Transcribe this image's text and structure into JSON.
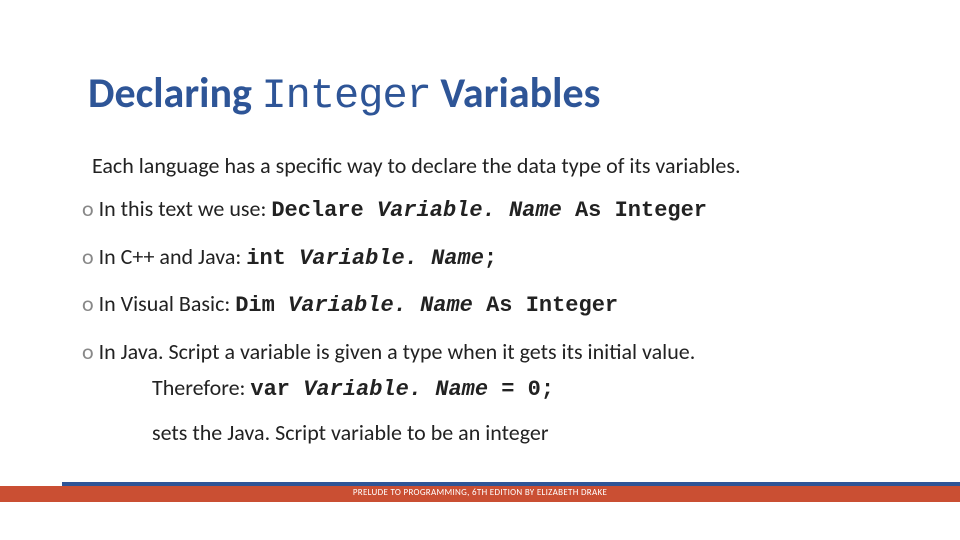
{
  "title": {
    "pre": "Declaring ",
    "mono": "Integer",
    "post": " Variables"
  },
  "intro": "Each language has a specific way to declare the data type of its variables.",
  "bullets": {
    "b1": {
      "pre": "In this text we use: ",
      "kw1": "Declare ",
      "var": "Variable. Name",
      "kw2": " As Integer"
    },
    "b2": {
      "pre": "In C++ and Java:    ",
      "kw1": "int ",
      "var": "Variable. Name",
      "semi": ";"
    },
    "b3": {
      "pre": "In Visual Basic:        ",
      "kw1": "Dim ",
      "var": "Variable. Name",
      "kw2": " As Integer"
    },
    "b4": {
      "pre": "In Java. Script a variable is given a type when it gets its initial value.",
      "line2a": "Therefore:    ",
      "kw1": "var ",
      "var": "Variable. Name",
      "eq": " = 0;",
      "line3": "sets the Java. Script variable to be an integer"
    }
  },
  "footer": "PRELUDE TO PROGRAMMING, 6TH EDITION BY ELIZABETH DRAKE"
}
